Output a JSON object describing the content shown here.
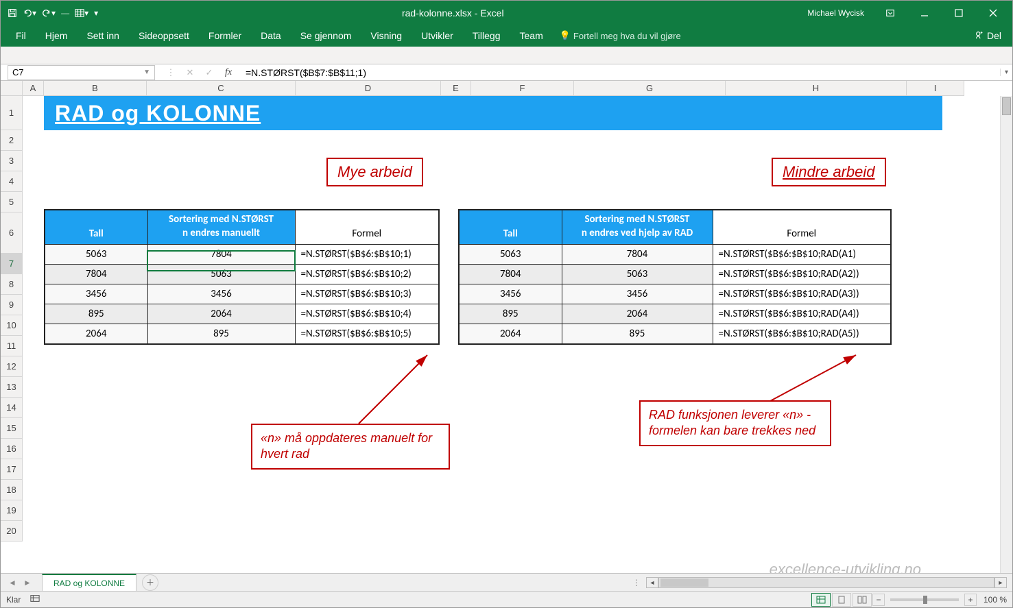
{
  "titlebar": {
    "doc_title": "rad-kolonne.xlsx - Excel",
    "user": "Michael Wycisk"
  },
  "ribbon": {
    "tabs": [
      "Fil",
      "Hjem",
      "Sett inn",
      "Sideoppsett",
      "Formler",
      "Data",
      "Se gjennom",
      "Visning",
      "Utvikler",
      "Tillegg",
      "Team"
    ],
    "tellme": "Fortell meg hva du vil gjøre",
    "share": "Del"
  },
  "formula_bar": {
    "cell_ref": "C7",
    "formula": "=N.STØRST($B$7:$B$11;1)"
  },
  "columns": {
    "labels": [
      "A",
      "B",
      "C",
      "D",
      "E",
      "F",
      "G",
      "H",
      "I"
    ],
    "widths": [
      31,
      150,
      217,
      212,
      44,
      150,
      221,
      264,
      84
    ]
  },
  "rows": {
    "count": 20,
    "heights": {
      "1": 50,
      "6": 60
    },
    "default_height": 30
  },
  "banner": "RAD og KOLONNE",
  "annot_top_left": "Mye arbeid",
  "annot_top_right": "Mindre arbeid",
  "annot_box_left": "«n» må oppdateres manuelt for hvert rad",
  "annot_box_right": "RAD funksjonen leverer «n» - formelen kan bare trekkes ned",
  "watermark": "excellence-utvikling.no",
  "table_left": {
    "headers": {
      "tall": "Tall",
      "sort": "Sortering med N.STØRST\nn endres manuellt",
      "formel": "Formel"
    },
    "rows": [
      {
        "tall": "5063",
        "sort": "7804",
        "formel": "=N.STØRST($B$6:$B$10;1)"
      },
      {
        "tall": "7804",
        "sort": "5063",
        "formel": "=N.STØRST($B$6:$B$10;2)"
      },
      {
        "tall": "3456",
        "sort": "3456",
        "formel": "=N.STØRST($B$6:$B$10;3)"
      },
      {
        "tall": "895",
        "sort": "2064",
        "formel": "=N.STØRST($B$6:$B$10;4)"
      },
      {
        "tall": "2064",
        "sort": "895",
        "formel": "=N.STØRST($B$6:$B$10;5)"
      }
    ]
  },
  "table_right": {
    "headers": {
      "tall": "Tall",
      "sort": "Sortering med N.STØRST\nn endres ved hjelp av RAD",
      "formel": "Formel"
    },
    "rows": [
      {
        "tall": "5063",
        "sort": "7804",
        "formel": "=N.STØRST($B$6:$B$10;RAD(A1)"
      },
      {
        "tall": "7804",
        "sort": "5063",
        "formel": "=N.STØRST($B$6:$B$10;RAD(A2))"
      },
      {
        "tall": "3456",
        "sort": "3456",
        "formel": "=N.STØRST($B$6:$B$10;RAD(A3))"
      },
      {
        "tall": "895",
        "sort": "2064",
        "formel": "=N.STØRST($B$6:$B$10;RAD(A4))"
      },
      {
        "tall": "2064",
        "sort": "895",
        "formel": "=N.STØRST($B$6:$B$10;RAD(A5))"
      }
    ]
  },
  "sheet_tab": "RAD og KOLONNE",
  "statusbar": {
    "ready": "Klar",
    "zoom": "100 %"
  }
}
